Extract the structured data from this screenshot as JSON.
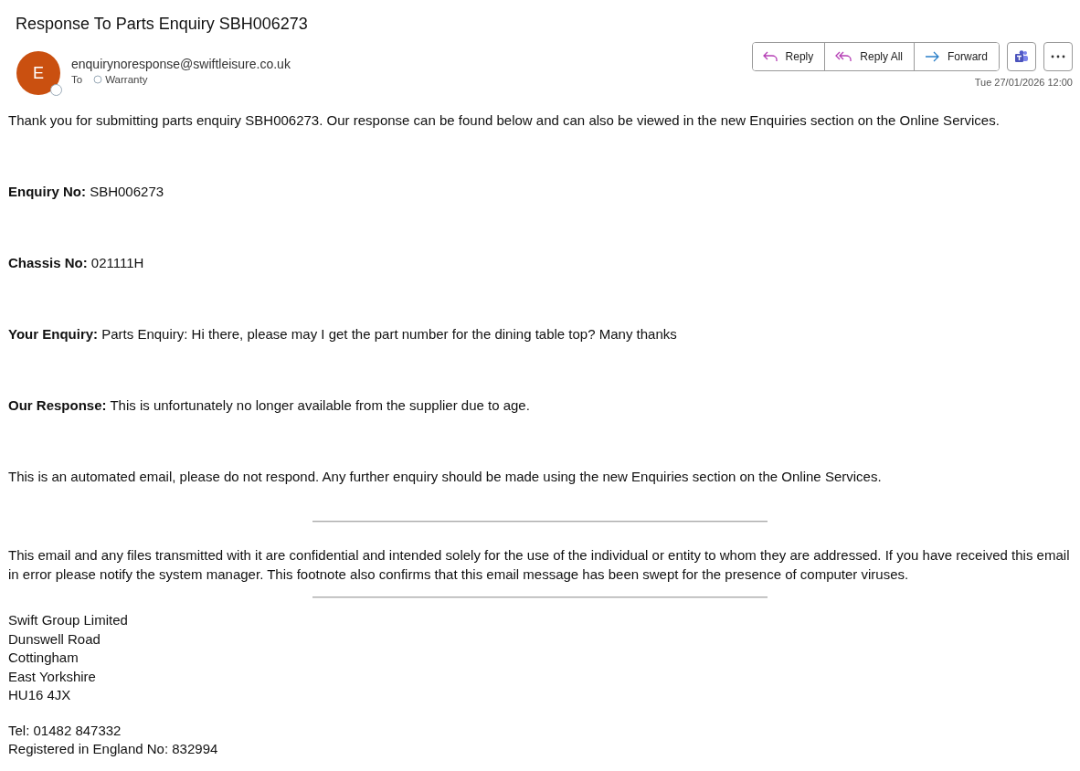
{
  "subject": "Response To Parts Enquiry SBH006273",
  "sender": {
    "avatar_letter": "E",
    "address": "enquirynoresponse@swiftleisure.co.uk",
    "to_label": "To",
    "recipient": "Warranty"
  },
  "actions": [
    {
      "kind": "reply",
      "label": "Reply"
    },
    {
      "kind": "reply_all",
      "label": "Reply All"
    },
    {
      "kind": "forward",
      "label": "Forward"
    }
  ],
  "date": "Tue 27/01/2026 12:00",
  "body": [
    {
      "kind": "paragraph",
      "text": "Thank you for submitting parts enquiry SBH006273. Our response can be found below and can also be viewed in the new Enquiries section on the Online Services."
    },
    {
      "kind": "paragraph",
      "text": "**Enquiry No:** SBH006273"
    },
    {
      "kind": "paragraph",
      "text": "**Chassis No:** 021111H"
    },
    {
      "kind": "paragraph",
      "text": "**Your Enquiry:** Parts Enquiry: Hi there, please may I get the part number for the dining table top? Many thanks"
    },
    {
      "kind": "paragraph",
      "text": "**Our Response:** This is unfortunately no longer available from the supplier due to age."
    },
    {
      "kind": "paragraph",
      "text": "This is an automated email, please do not respond. Any further enquiry should be made using the new Enquiries section on the Online Services."
    }
  ],
  "footer": {
    "disclaimer": "This email and any files transmitted with it are confidential and intended solely for the use of the individual or entity to whom they are addressed. If you have received this email in error please notify the system manager. This footnote also confirms that this email message has been swept for the presence of computer viruses.",
    "address_lines": [
      "Swift Group Limited",
      "Dunswell Road",
      "Cottingham",
      "East Yorkshire",
      "HU16 4JX"
    ],
    "contact_lines": [
      "Tel: 01482 847332",
      "Registered in England No: 832994"
    ]
  }
}
